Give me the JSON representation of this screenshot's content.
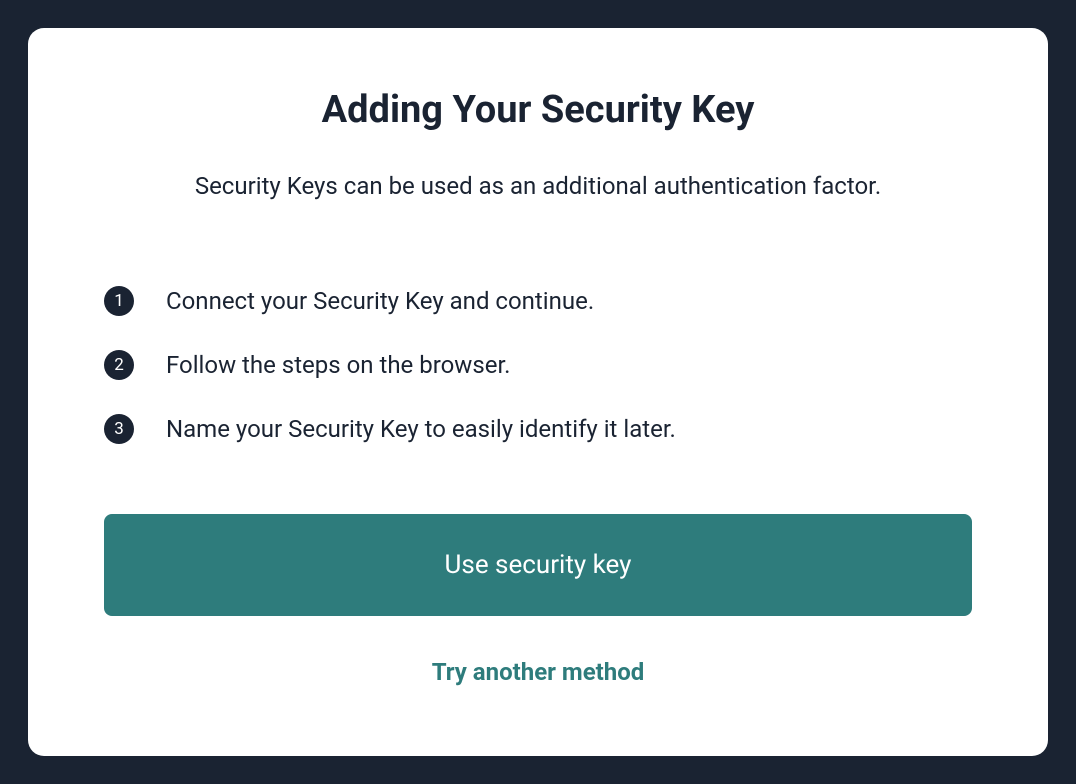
{
  "modal": {
    "title": "Adding Your Security Key",
    "subtitle": "Security Keys can be used as an additional authentication factor.",
    "steps": [
      {
        "number": "1",
        "text": "Connect your Security Key and continue."
      },
      {
        "number": "2",
        "text": "Follow the steps on the browser."
      },
      {
        "number": "3",
        "text": "Name your Security Key to easily identify it later."
      }
    ],
    "primary_button_label": "Use security key",
    "secondary_link_label": "Try another method"
  },
  "colors": {
    "background": "#1a2332",
    "card_bg": "#ffffff",
    "accent": "#2e7c7c",
    "text": "#1a2332"
  }
}
